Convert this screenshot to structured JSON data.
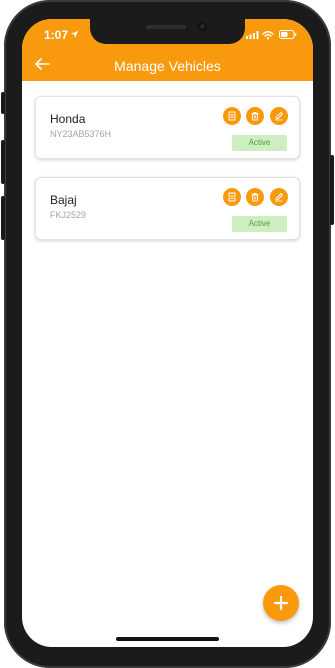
{
  "status_bar": {
    "time": "1:07",
    "icons": [
      "location-arrow-icon",
      "signal-icon",
      "wifi-icon",
      "battery-icon"
    ]
  },
  "header": {
    "title": "Manage Vehicles",
    "back_icon": "back-arrow-icon",
    "background": "#F99A0E"
  },
  "vehicles": [
    {
      "name": "Honda",
      "plate": "NY23AB5376H",
      "status": "Active",
      "actions": [
        "document-icon",
        "trash-icon",
        "edit-icon"
      ]
    },
    {
      "name": "Bajaj",
      "plate": "FKJ2529",
      "status": "Active",
      "actions": [
        "document-icon",
        "trash-icon",
        "edit-icon"
      ]
    }
  ],
  "fab": {
    "icon": "plus-icon"
  },
  "colors": {
    "accent": "#F99A0E",
    "badge_bg": "#cdeec0",
    "badge_text": "#4aa136"
  }
}
